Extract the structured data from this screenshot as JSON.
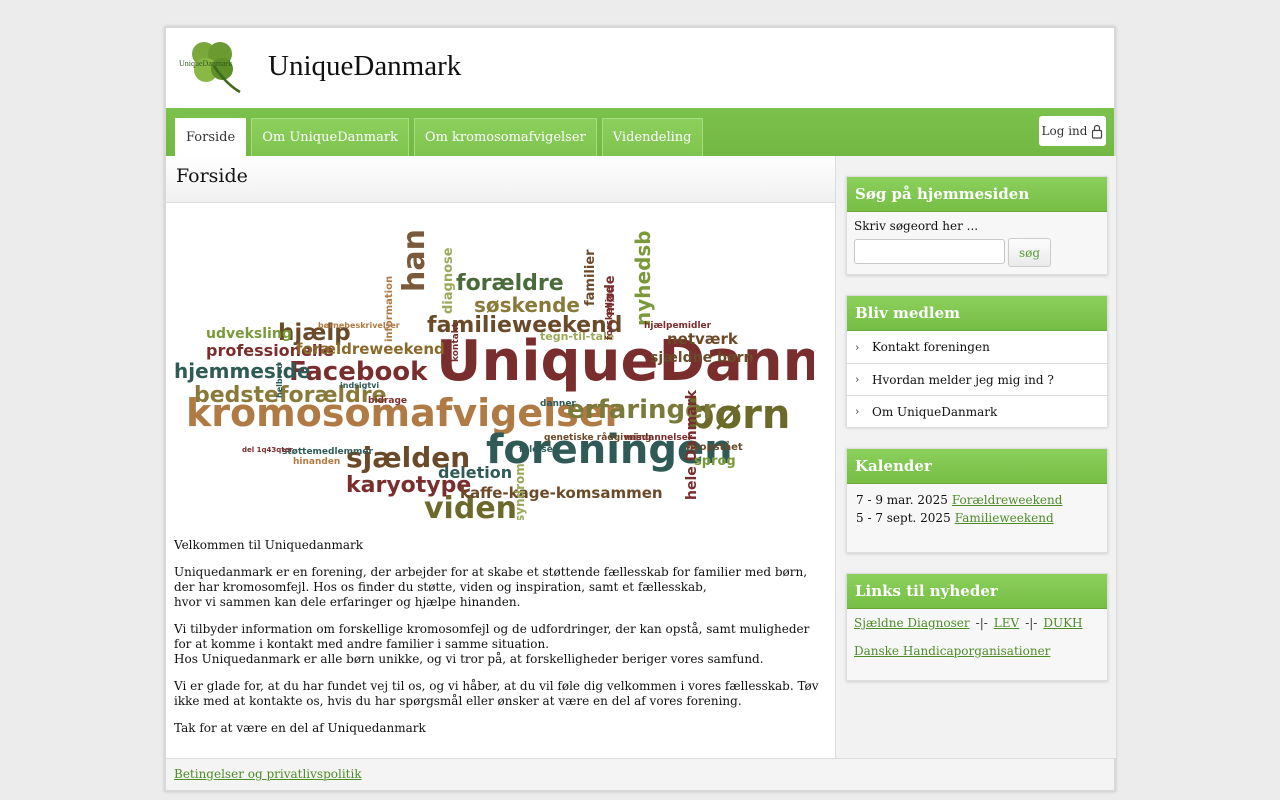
{
  "site": {
    "title": "UniqueDanmark",
    "logo_text": "UniqueDanmark"
  },
  "nav": {
    "tabs": [
      {
        "label": "Forside"
      },
      {
        "label": "Om UniqueDanmark"
      },
      {
        "label": "Om kromosomafvigelser"
      },
      {
        "label": "Videndeling"
      }
    ],
    "login_label": "Log ind"
  },
  "main": {
    "page_title": "Forside",
    "paragraphs": [
      "Velkommen til Uniquedanmark",
      "Uniquedanmark er en forening, der arbejder for at skabe et støttende fællesskab for familier med børn, der har kromosomfejl. Hos os finder du støtte, viden og inspiration, samt et fællesskab,\nhvor vi sammen kan dele erfaringer og hjælpe hinanden.",
      "Vi tilbyder information om forskellige kromosomfejl og de udfordringer, der kan opstå, samt muligheder for at komme i kontakt med andre familier i samme situation.\nHos Uniquedanmark er alle børn unikke, og vi tror på, at forskelligheder beriger vores samfund.",
      "Vi er glade for, at du har fundet vej til os, og vi håber, at du vil føle dig velkommen i vores fællesskab. Tøv ikke med at kontakte os, hvis du har spørgsmål eller ønsker at være en del af vores forening.",
      "Tak for at være en del af Uniquedanmark"
    ],
    "wordcloud": [
      {
        "t": "UniqueDanmark",
        "c": "#7a2d2d"
      },
      {
        "t": "kromosomafvigelser",
        "c": "#b07a44"
      },
      {
        "t": "foreningen",
        "c": "#2f5a55"
      },
      {
        "t": "Facebook",
        "c": "#7a2d2d"
      },
      {
        "t": "handicap",
        "c": "#7a5a3a"
      },
      {
        "t": "børn",
        "c": "#6b6a2a"
      },
      {
        "t": "erfaringer",
        "c": "#7a7a3a"
      },
      {
        "t": "familieweekend",
        "c": "#6b4a2a"
      },
      {
        "t": "forældre",
        "c": "#4a6a3a"
      },
      {
        "t": "søskende",
        "c": "#8a7a3a"
      },
      {
        "t": "sjælden",
        "c": "#6b4a2a"
      },
      {
        "t": "karyotype",
        "c": "#7a2d2d"
      },
      {
        "t": "viden",
        "c": "#6b6a2a"
      },
      {
        "t": "hjemmeside",
        "c": "#2f5a55"
      },
      {
        "t": "bedsteforældre",
        "c": "#8a7a3a"
      },
      {
        "t": "hjælp",
        "c": "#6b4a2a"
      },
      {
        "t": "professionelle",
        "c": "#7a2d2d"
      },
      {
        "t": "udveksling",
        "c": "#7a9a3a"
      },
      {
        "t": "forældreweekend",
        "c": "#8a6a2a"
      },
      {
        "t": "nyhedsbrev",
        "c": "#7a9a3a"
      },
      {
        "t": "diagnose",
        "c": "#9aaa5a"
      },
      {
        "t": "familier",
        "c": "#6b4a2a"
      },
      {
        "t": "møde",
        "c": "#7a2d2d"
      },
      {
        "t": "netværk",
        "c": "#6b4a2a"
      },
      {
        "t": "sjældne børn",
        "c": "#6b4a2a"
      },
      {
        "t": "tegn-til-tale",
        "c": "#9aaa5a"
      },
      {
        "t": "deletion",
        "c": "#2f5a55"
      },
      {
        "t": "kaffe-kage-komsammen",
        "c": "#6b4a2a"
      },
      {
        "t": "syndrom",
        "c": "#9aaa5a"
      },
      {
        "t": "hele Danmark",
        "c": "#7a2d2d"
      },
      {
        "t": "sprog",
        "c": "#7a9a3a"
      },
      {
        "t": "nyopstået",
        "c": "#6b4a2a"
      },
      {
        "t": "information",
        "c": "#b07a44"
      },
      {
        "t": "kontakt",
        "c": "#7a2d2d"
      },
      {
        "t": "danner",
        "c": "#2f5a55"
      },
      {
        "t": "genetiske rådgivning",
        "c": "#6b4a2a"
      },
      {
        "t": "misdannelser",
        "c": "#7a2d2d"
      },
      {
        "t": "følelser",
        "c": "#2f5a55"
      },
      {
        "t": "bidrage",
        "c": "#7a2d2d"
      },
      {
        "t": "indsigtvi",
        "c": "#2f5a55"
      },
      {
        "t": "hinanden",
        "c": "#b07a44"
      },
      {
        "t": "støttemedlemmer",
        "c": "#2f5a55"
      },
      {
        "t": "del 1q43qter",
        "c": "#7a2d2d"
      },
      {
        "t": "børnebeskrivelser",
        "c": "#b07a44"
      },
      {
        "t": "hjælpemidler",
        "c": "#7a2d2d"
      },
      {
        "t": "forskellige",
        "c": "#7a2d2d"
      },
      {
        "t": "helbred",
        "c": "#2f5a55"
      }
    ]
  },
  "sidebar": {
    "search": {
      "title": "Søg på hjemmesiden",
      "label": "Skriv søgeord her ...",
      "placeholder": "",
      "button": "søg"
    },
    "member": {
      "title": "Bliv medlem",
      "items": [
        "Kontakt foreningen",
        "Hvordan melder jeg mig ind ?",
        "Om UniqueDanmark"
      ]
    },
    "calendar": {
      "title": "Kalender",
      "events": [
        {
          "date": "7 - 9 mar. 2025",
          "name": "Forældreweekend"
        },
        {
          "date": "5 - 7 sept. 2025",
          "name": "Familieweekend"
        }
      ]
    },
    "links": {
      "title": "Links til nyheder",
      "items": [
        "Sjældne Diagnoser",
        "LEV",
        "DUKH",
        "Danske Handicaporganisationer"
      ],
      "separator": "-|-"
    }
  },
  "footer": {
    "link": "Betingelser og privatlivspolitik"
  },
  "colors": {
    "green": "#76be46",
    "link": "#4d8c28"
  }
}
